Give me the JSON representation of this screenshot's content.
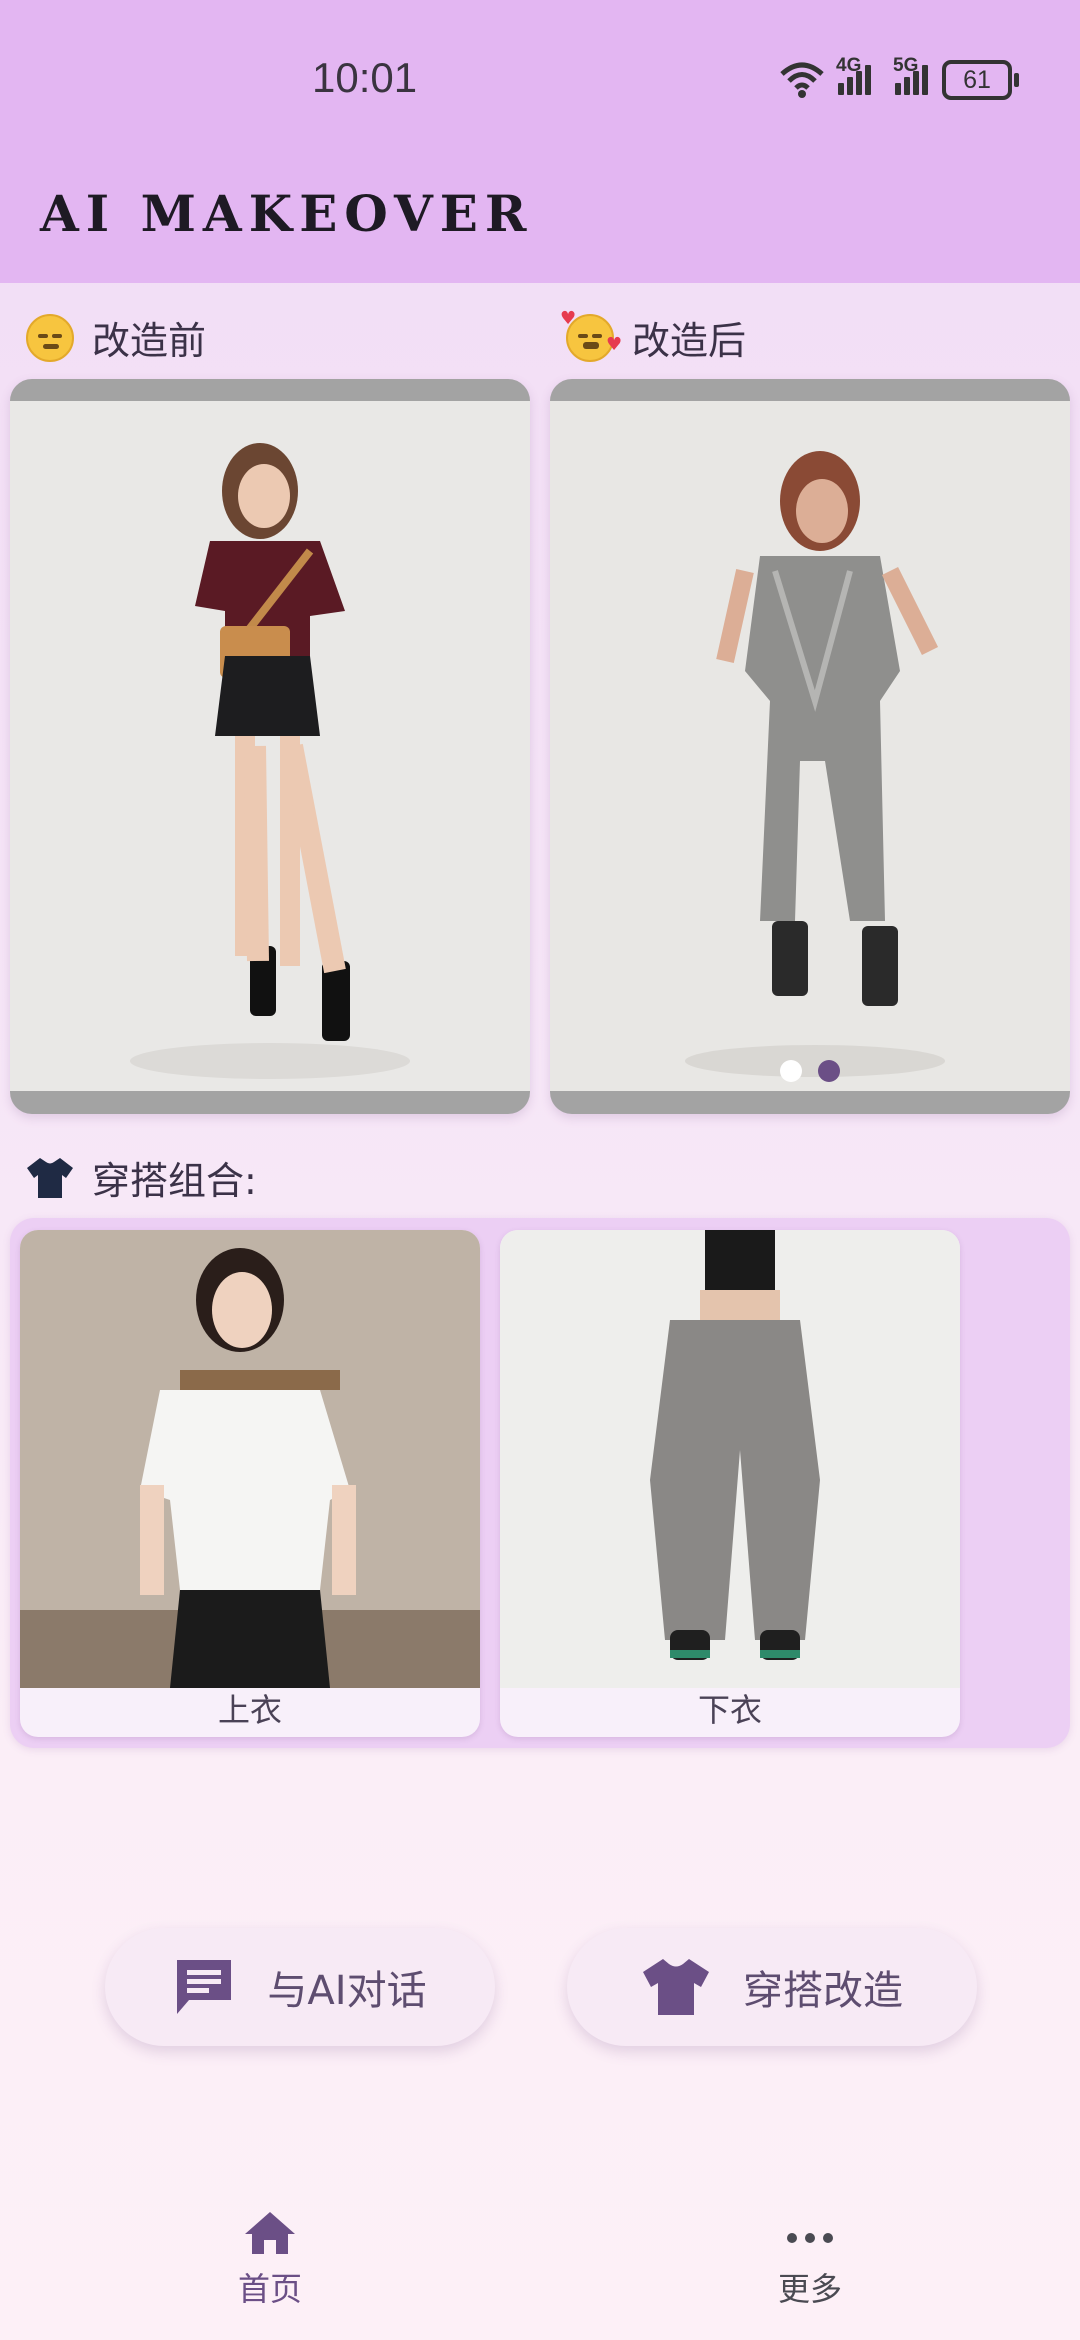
{
  "status_bar": {
    "time": "10:01",
    "net1": "4G",
    "net2": "5G",
    "battery": "61"
  },
  "app": {
    "title": "AI MAKEOVER"
  },
  "before": {
    "label": "改造前"
  },
  "after": {
    "label": "改造后",
    "carousel_page": 2,
    "carousel_total": 2
  },
  "outfit": {
    "label": "穿搭组合:",
    "items": [
      {
        "caption": "上衣"
      },
      {
        "caption": "下衣"
      }
    ]
  },
  "actions": {
    "chat": "与AI对话",
    "makeover": "穿搭改造"
  },
  "nav": {
    "home": "首页",
    "more": "更多"
  },
  "colors": {
    "header": "#e3b6f2",
    "accent": "#6b4f86",
    "nav_active": "#6b4f86",
    "nav_inactive": "#4a4a52"
  }
}
